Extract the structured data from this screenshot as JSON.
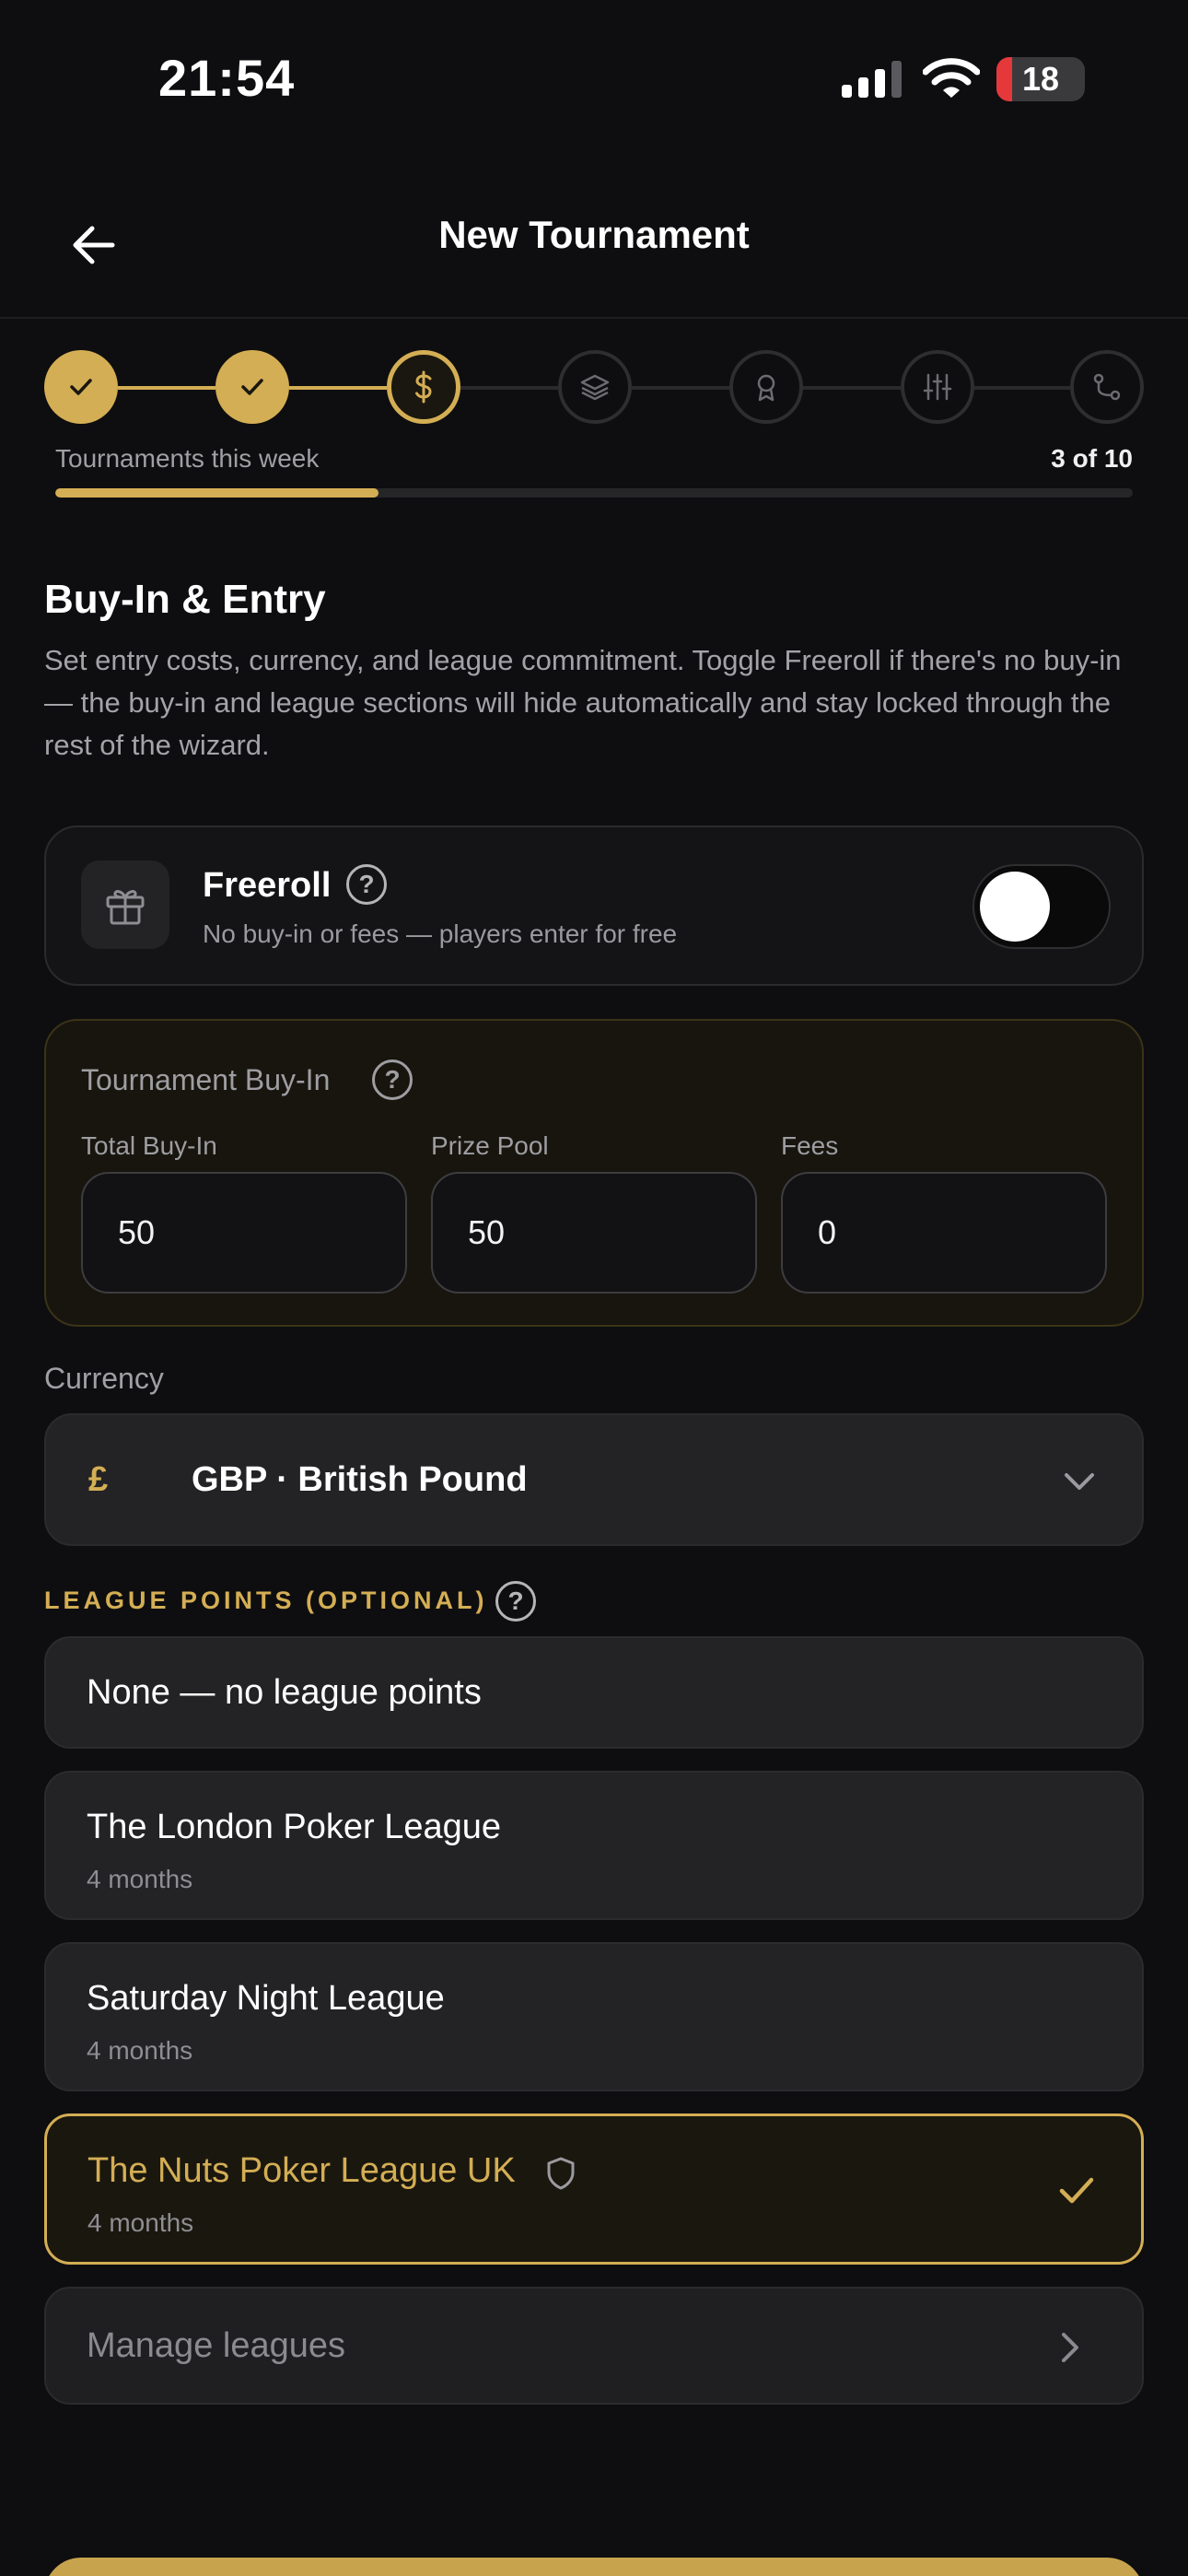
{
  "status_bar": {
    "time": "21:54",
    "battery": "18",
    "battery_level_percent": 18
  },
  "header": {
    "title": "New Tournament"
  },
  "stepper": {
    "current_step": 3,
    "steps": [
      {
        "icon": "check-icon",
        "state": "done"
      },
      {
        "icon": "check-icon",
        "state": "done"
      },
      {
        "icon": "dollar-icon",
        "state": "current"
      },
      {
        "icon": "layers-icon",
        "state": "future"
      },
      {
        "icon": "award-icon",
        "state": "future"
      },
      {
        "icon": "sliders-icon",
        "state": "future"
      },
      {
        "icon": "route-icon",
        "state": "future"
      }
    ]
  },
  "weekly_progress": {
    "label": "Tournaments this week",
    "count_text": "3 of 10",
    "value": 3,
    "max": 10
  },
  "section": {
    "title": "Buy-In & Entry",
    "description": "Set entry costs, currency, and league commitment. Toggle Freeroll if there's no buy-in — the buy-in and league sections will hide automatically and stay locked through the rest of the wizard."
  },
  "freeroll": {
    "title": "Freeroll",
    "subtitle": "No buy-in or fees — players enter for free",
    "enabled": false
  },
  "buy_in": {
    "title": "Tournament Buy-In",
    "fields": [
      {
        "label": "Total Buy-In",
        "value": "50"
      },
      {
        "label": "Prize Pool",
        "value": "50"
      },
      {
        "label": "Fees",
        "value": "0"
      }
    ]
  },
  "currency": {
    "label": "Currency",
    "symbol": "£",
    "selected": "GBP · British Pound"
  },
  "league": {
    "label": "LEAGUE POINTS (OPTIONAL)",
    "options": [
      {
        "title": "None — no league points",
        "subtitle": ""
      },
      {
        "title": "The London Poker League",
        "subtitle": "4 months"
      },
      {
        "title": "Saturday Night League",
        "subtitle": "4 months"
      },
      {
        "title": "The Nuts Poker League UK",
        "subtitle": "4 months",
        "selected": true
      }
    ],
    "manage_label": "Manage leagues"
  },
  "colors": {
    "accent": "#d4ae54",
    "background": "#0e0e10",
    "card": "#232326"
  }
}
